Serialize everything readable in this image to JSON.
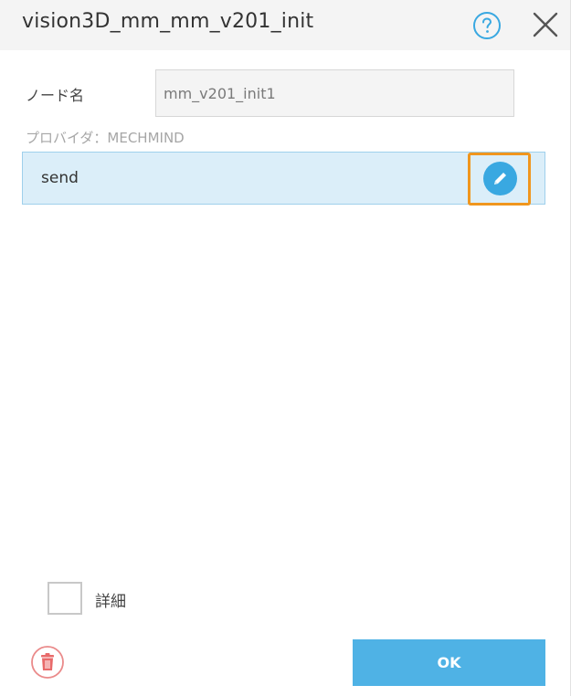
{
  "dialog": {
    "title": "vision3D_mm_mm_v201_init",
    "help_icon": "question-circle-icon",
    "close_icon": "close-x-icon"
  },
  "node": {
    "label": "ノード名",
    "value": "mm_v201_init1"
  },
  "provider": {
    "text": "プロバイダ：MECHMIND"
  },
  "items": [
    {
      "label": "send",
      "action_icon": "pencil-edit-icon"
    }
  ],
  "details": {
    "label": "詳細",
    "checked": false
  },
  "footer": {
    "delete_icon": "trash-icon",
    "ok_label": "OK"
  },
  "colors": {
    "accent": "#39a8e1",
    "ok_button": "#4fb2e5",
    "selected_row_bg": "#dbeef9",
    "highlight": "#f0961e",
    "delete": "#e86a6a"
  }
}
